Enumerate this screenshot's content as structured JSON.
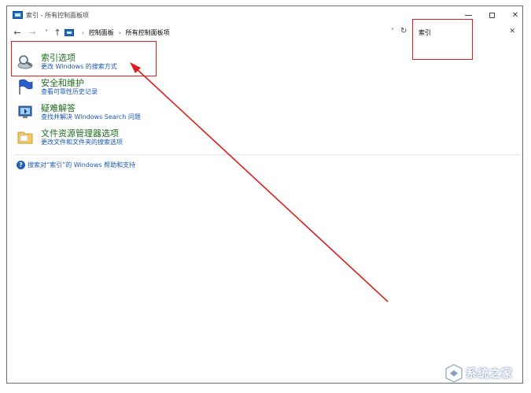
{
  "window": {
    "title": "索引 - 所有控制面板项"
  },
  "navbar": {
    "breadcrumb": [
      "控制面板",
      "所有控制面板项"
    ],
    "search_value": "索引"
  },
  "items": [
    {
      "title": "索引选项",
      "subtitle": "更改 Windows 的搜索方式",
      "icon": "indexing-options-icon"
    },
    {
      "title": "安全和维护",
      "subtitle": "查看可靠性历史记录",
      "icon": "security-maintenance-flag-icon"
    },
    {
      "title": "疑难解答",
      "subtitle": "查找并解决 Windows Search 问题",
      "icon": "troubleshooting-icon"
    },
    {
      "title": "文件资源管理器选项",
      "subtitle": "更改文件和文件夹的搜索选项",
      "icon": "file-explorer-options-icon"
    }
  ],
  "help": {
    "text": "搜索对“索引”的 Windows 帮助和支持"
  },
  "watermark": {
    "text": "系统之家"
  },
  "colors": {
    "title_green": "#1e6a1e",
    "link_blue": "#1a56b8",
    "annotation_red": "#dc1f1f"
  }
}
